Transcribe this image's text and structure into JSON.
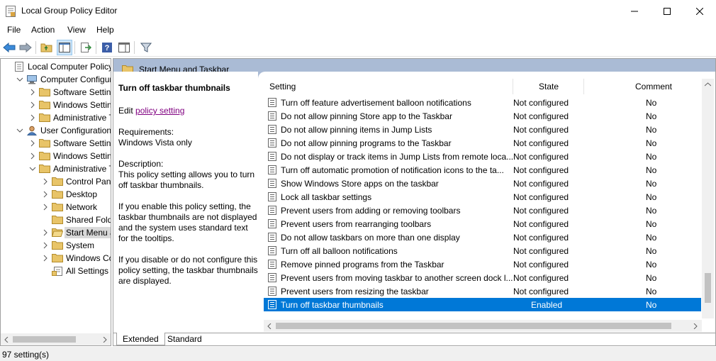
{
  "window": {
    "title": "Local Group Policy Editor",
    "icon": "policy-editor-icon"
  },
  "menu": [
    "File",
    "Action",
    "View",
    "Help"
  ],
  "tree": {
    "items": [
      {
        "label": "Local Computer Policy",
        "icon": "computer-policy-icon",
        "expander": "none"
      },
      {
        "label": "Computer Configura",
        "icon": "computer-icon",
        "expander": "expanded"
      },
      {
        "label": "Software Settings",
        "icon": "folder-icon",
        "expander": "collapsed"
      },
      {
        "label": "Windows Setting",
        "icon": "folder-icon",
        "expander": "collapsed"
      },
      {
        "label": "Administrative Te",
        "icon": "folder-icon",
        "expander": "collapsed"
      },
      {
        "label": "User Configuration",
        "icon": "user-icon",
        "expander": "expanded"
      },
      {
        "label": "Software Settings",
        "icon": "folder-icon",
        "expander": "collapsed"
      },
      {
        "label": "Windows Setting",
        "icon": "folder-icon",
        "expander": "collapsed"
      },
      {
        "label": "Administrative Te",
        "icon": "folder-icon",
        "expander": "expanded"
      },
      {
        "label": "Control Panel",
        "icon": "folder-icon",
        "expander": "collapsed"
      },
      {
        "label": "Desktop",
        "icon": "folder-icon",
        "expander": "collapsed"
      },
      {
        "label": "Network",
        "icon": "folder-icon",
        "expander": "collapsed"
      },
      {
        "label": "Shared Folder",
        "icon": "folder-icon",
        "expander": "none"
      },
      {
        "label": "Start Menu ar",
        "icon": "folder-open-icon",
        "expander": "collapsed",
        "selected": true
      },
      {
        "label": "System",
        "icon": "folder-icon",
        "expander": "collapsed"
      },
      {
        "label": "Windows Cor",
        "icon": "folder-icon",
        "expander": "collapsed"
      },
      {
        "label": "All Settings",
        "icon": "all-settings-icon",
        "expander": "none"
      }
    ]
  },
  "header": {
    "title": "Start Menu and Taskbar"
  },
  "description": {
    "title": "Turn off taskbar thumbnails",
    "edit_prefix": "Edit ",
    "edit_link": "policy setting",
    "req_label": "Requirements:",
    "req_value": "Windows Vista only",
    "desc_label": "Description:",
    "desc_p1": "This policy setting allows you to turn off taskbar thumbnails.",
    "desc_p2": "If you enable this policy setting, the taskbar thumbnails are not displayed and the system uses standard text for the tooltips.",
    "desc_p3": "If you disable or do not configure this policy setting, the taskbar thumbnails are displayed."
  },
  "list": {
    "columns": {
      "setting": "Setting",
      "state": "State",
      "comment": "Comment"
    },
    "rows": [
      {
        "setting": "Turn off feature advertisement balloon notifications",
        "state": "Not configured",
        "comment": "No"
      },
      {
        "setting": "Do not allow pinning Store app to the Taskbar",
        "state": "Not configured",
        "comment": "No"
      },
      {
        "setting": "Do not allow pinning items in Jump Lists",
        "state": "Not configured",
        "comment": "No"
      },
      {
        "setting": "Do not allow pinning programs to the Taskbar",
        "state": "Not configured",
        "comment": "No"
      },
      {
        "setting": "Do not display or track items in Jump Lists from remote loca...",
        "state": "Not configured",
        "comment": "No"
      },
      {
        "setting": "Turn off automatic promotion of notification icons to the ta...",
        "state": "Not configured",
        "comment": "No"
      },
      {
        "setting": "Show Windows Store apps on the taskbar",
        "state": "Not configured",
        "comment": "No"
      },
      {
        "setting": "Lock all taskbar settings",
        "state": "Not configured",
        "comment": "No"
      },
      {
        "setting": "Prevent users from adding or removing toolbars",
        "state": "Not configured",
        "comment": "No"
      },
      {
        "setting": "Prevent users from rearranging toolbars",
        "state": "Not configured",
        "comment": "No"
      },
      {
        "setting": "Do not allow taskbars on more than one display",
        "state": "Not configured",
        "comment": "No"
      },
      {
        "setting": "Turn off all balloon notifications",
        "state": "Not configured",
        "comment": "No"
      },
      {
        "setting": "Remove pinned programs from the Taskbar",
        "state": "Not configured",
        "comment": "No"
      },
      {
        "setting": "Prevent users from moving taskbar to another screen dock l...",
        "state": "Not configured",
        "comment": "No"
      },
      {
        "setting": "Prevent users from resizing the taskbar",
        "state": "Not configured",
        "comment": "No"
      },
      {
        "setting": "Turn off taskbar thumbnails",
        "state": "Enabled",
        "comment": "No",
        "selected": true
      }
    ]
  },
  "tabs": [
    "Extended",
    "Standard"
  ],
  "status": "97 setting(s)",
  "colors": {
    "selection": "#0078d7",
    "header_band": "#aabbd5",
    "folder": "#e8c468",
    "link": "#800080"
  }
}
